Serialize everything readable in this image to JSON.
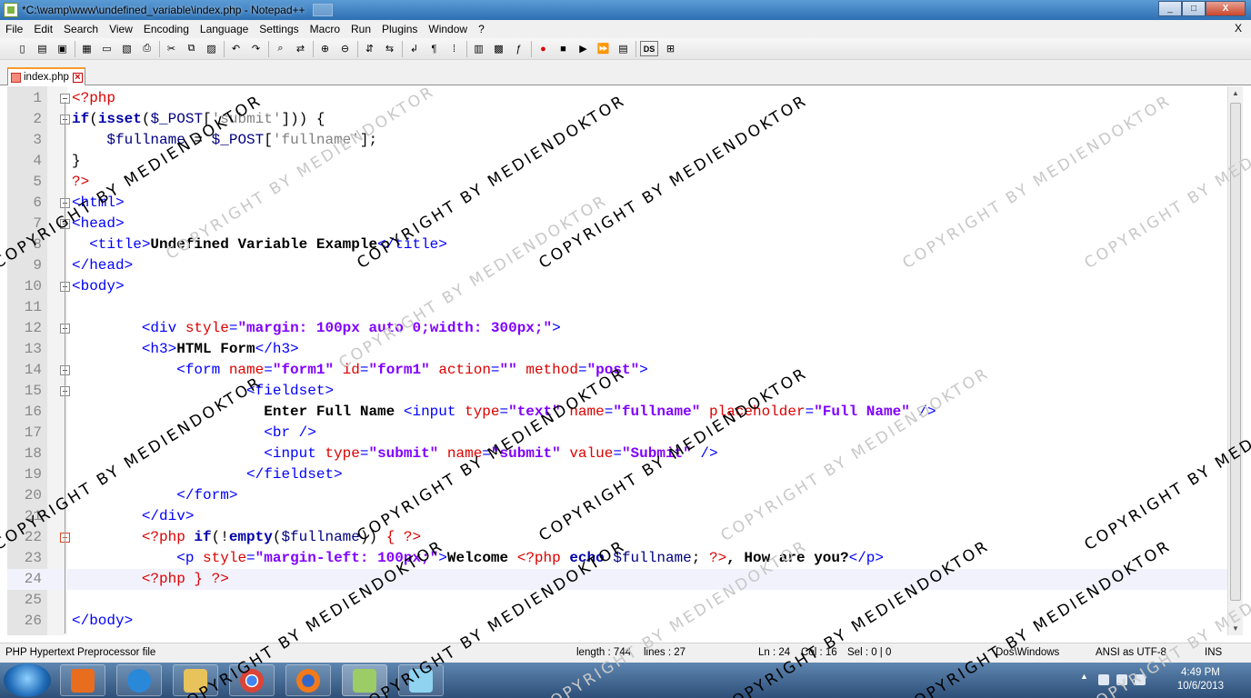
{
  "window": {
    "title": "*C:\\wamp\\www\\undefined_variable\\index.php - Notepad++",
    "buttons": [
      "_",
      "□",
      "X"
    ]
  },
  "menu": {
    "items": [
      "File",
      "Edit",
      "Search",
      "View",
      "Encoding",
      "Language",
      "Settings",
      "Macro",
      "Run",
      "Plugins",
      "Window",
      "?"
    ],
    "close": "X"
  },
  "toolbar": {
    "icons": [
      "new-file-icon",
      "open-icon",
      "save-icon",
      "save-all-icon",
      "close-icon",
      "close-all-icon",
      "print-icon",
      "cut-icon",
      "copy-icon",
      "paste-icon",
      "undo-icon",
      "redo-icon",
      "find-icon",
      "replace-icon",
      "zoom-in-icon",
      "zoom-out-icon",
      "sync-v-icon",
      "sync-h-icon",
      "wrap-icon",
      "all-chars-icon",
      "indent-guide-icon",
      "udl-icon",
      "doc-map-icon",
      "function-list-icon",
      "record-icon",
      "stop-icon",
      "play-icon",
      "play-multi-icon",
      "save-macro-icon",
      "ds-icon",
      "plugin-icon"
    ],
    "ds_label": "DS"
  },
  "tabs": [
    {
      "label": "index.php",
      "modified": true
    }
  ],
  "editor": {
    "current_line": 24,
    "lines": [
      {
        "n": "1",
        "fold": "open",
        "html": "<span class='c-php'>&lt;?php</span>"
      },
      {
        "n": "2",
        "fold": "open",
        "html": "<span class='c-kw'>if</span><span class='c-pl'>(</span><span class='c-kw'>isset</span><span class='c-pl'>(</span><span class='c-var'>$_POST</span><span class='c-pl'>[</span><span class='c-str'>'submit'</span><span class='c-pl'>])) {</span>"
      },
      {
        "n": "3",
        "fold": "",
        "html": "    <span class='c-var'>$fullname</span><span class='c-pl'> = </span><span class='c-var'>$_POST</span><span class='c-pl'>[</span><span class='c-str'>'fullname'</span><span class='c-pl'>];</span>"
      },
      {
        "n": "4",
        "fold": "",
        "html": "<span class='c-pl'>}</span>"
      },
      {
        "n": "5",
        "fold": "",
        "html": "<span class='c-php'>?&gt;</span>"
      },
      {
        "n": "6",
        "fold": "open",
        "html": "<span class='c-tag'>&lt;html&gt;</span>"
      },
      {
        "n": "7",
        "fold": "open",
        "html": "<span class='c-tag'>&lt;head&gt;</span>"
      },
      {
        "n": "8",
        "fold": "",
        "html": "  <span class='c-tag'>&lt;title&gt;</span><span class='c-txt'>Undefined Variable Example</span><span class='c-tag'>&lt;/title&gt;</span>"
      },
      {
        "n": "9",
        "fold": "",
        "html": "<span class='c-tag'>&lt;/head&gt;</span>"
      },
      {
        "n": "10",
        "fold": "open",
        "html": "<span class='c-tag'>&lt;body&gt;</span>"
      },
      {
        "n": "11",
        "fold": "",
        "html": ""
      },
      {
        "n": "12",
        "fold": "open",
        "html": "        <span class='c-tag'>&lt;div </span><span class='c-attr'>style</span><span class='c-tag'>=</span><span class='c-val'>\"margin: 100px auto 0;width: 300px;\"</span><span class='c-tag'>&gt;</span>"
      },
      {
        "n": "13",
        "fold": "",
        "html": "        <span class='c-tag'>&lt;h3&gt;</span><span class='c-txt'>HTML Form</span><span class='c-tag'>&lt;/h3&gt;</span>"
      },
      {
        "n": "14",
        "fold": "open",
        "html": "            <span class='c-tag'>&lt;form </span><span class='c-attr'>name</span><span class='c-tag'>=</span><span class='c-val'>\"form1\"</span><span class='c-tag'> </span><span class='c-attr'>id</span><span class='c-tag'>=</span><span class='c-val'>\"form1\"</span><span class='c-tag'> </span><span class='c-attr'>action</span><span class='c-tag'>=</span><span class='c-val'>\"\"</span><span class='c-tag'> </span><span class='c-attr'>method</span><span class='c-tag'>=</span><span class='c-val'>\"post\"</span><span class='c-tag'>&gt;</span>"
      },
      {
        "n": "15",
        "fold": "open",
        "html": "                    <span class='c-tag'>&lt;fieldset&gt;</span>"
      },
      {
        "n": "16",
        "fold": "",
        "html": "                      <span class='c-txt'>Enter Full Name </span><span class='c-tag'>&lt;input </span><span class='c-attr'>type</span><span class='c-tag'>=</span><span class='c-val'>\"text\"</span><span class='c-tag'> </span><span class='c-attr'>name</span><span class='c-tag'>=</span><span class='c-val'>\"fullname\"</span><span class='c-tag'> </span><span class='c-attr'>placeholder</span><span class='c-tag'>=</span><span class='c-val'>\"Full Name\"</span><span class='c-tag'> /&gt;</span>"
      },
      {
        "n": "17",
        "fold": "",
        "html": "                      <span class='c-tag'>&lt;br /&gt;</span>"
      },
      {
        "n": "18",
        "fold": "",
        "html": "                      <span class='c-tag'>&lt;input </span><span class='c-attr'>type</span><span class='c-tag'>=</span><span class='c-val'>\"submit\"</span><span class='c-tag'> </span><span class='c-attr'>name</span><span class='c-tag'>=</span><span class='c-val'>\"submit\"</span><span class='c-tag'> </span><span class='c-attr'>value</span><span class='c-tag'>=</span><span class='c-val'>\"Submit\"</span><span class='c-tag'> /&gt;</span>"
      },
      {
        "n": "19",
        "fold": "",
        "html": "                    <span class='c-tag'>&lt;/fieldset&gt;</span>"
      },
      {
        "n": "20",
        "fold": "",
        "html": "            <span class='c-tag'>&lt;/form&gt;</span>"
      },
      {
        "n": "21",
        "fold": "",
        "html": "        <span class='c-tag'>&lt;/div&gt;</span>"
      },
      {
        "n": "22",
        "fold": "red",
        "html": "        <span class='c-php'>&lt;?php </span><span class='c-kw'>if</span><span class='c-pl'>(!</span><span class='c-kw'>empty</span><span class='c-pl'>(</span><span class='c-var'>$fullname</span><span class='c-pl'>)) </span><span class='c-php'>{ ?&gt;</span>"
      },
      {
        "n": "23",
        "fold": "",
        "html": "            <span class='c-tag'>&lt;p </span><span class='c-attr'>style</span><span class='c-tag'>=</span><span class='c-val'>\"margin-left: 100px;\"</span><span class='c-tag'>&gt;</span><span class='c-txt'>Welcome </span><span class='c-php'>&lt;?php </span><span class='c-kw'>echo</span><span class='c-pl'> </span><span class='c-var'>$fullname</span><span class='c-pl'>; </span><span class='c-php'>?&gt;</span><span class='c-txt'>, How are you?</span><span class='c-tag'>&lt;/p&gt;</span>"
      },
      {
        "n": "24",
        "fold": "",
        "html": "        <span class='c-php'>&lt;?php } ?&gt;</span>"
      },
      {
        "n": "25",
        "fold": "",
        "html": ""
      },
      {
        "n": "26",
        "fold": "",
        "html": "<span class='c-tag'>&lt;/body&gt;</span>"
      }
    ]
  },
  "status": {
    "filetype": "PHP Hypertext Preprocessor file",
    "length": "length : 744",
    "lines": "lines : 27",
    "ln": "Ln : 24",
    "col": "Col : 16",
    "sel": "Sel : 0 | 0",
    "eol": "Dos\\Windows",
    "encoding": "ANSI as UTF-8",
    "mode": "INS"
  },
  "taskbar": {
    "apps": [
      "media-player-icon",
      "internet-explorer-icon",
      "file-explorer-icon",
      "chrome-icon",
      "firefox-icon",
      "notepadpp-icon",
      "notepad-icon"
    ],
    "time": "4:49 PM",
    "date": "10/6/2013"
  },
  "watermark": {
    "text": "COPYRIGHT BY MEDIENDOKTOR"
  },
  "colors": {
    "title_bar": "#2d6fb3",
    "tab_accent": "#fa9a2a",
    "php_delim": "#dd0000",
    "keyword": "#0000aa",
    "tag": "#0000ff",
    "attr_value": "#8000ff"
  }
}
